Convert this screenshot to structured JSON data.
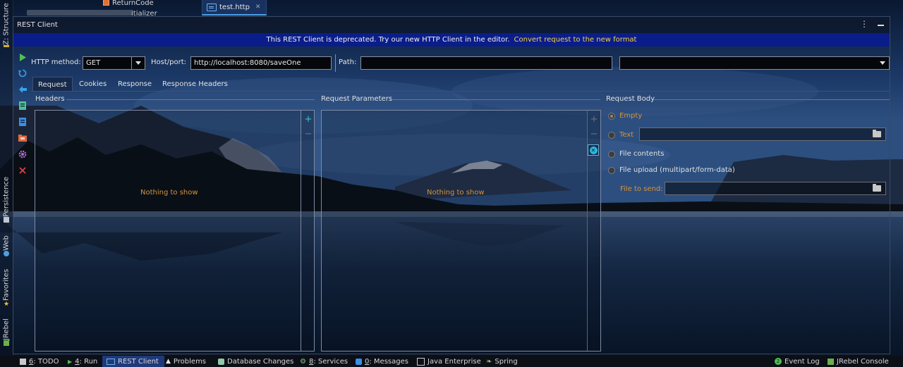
{
  "colors": {
    "banner_bg": "#0a1d8a",
    "banner_link": "#f3d24f",
    "empty_text": "#d7923a",
    "add_icon": "#3ac7c0",
    "status_active": "#1f3a7a"
  },
  "top": {
    "tree_item": "ReturnCode",
    "tree_item2": "itializer",
    "editor_tab": "test.http"
  },
  "left_tabs": [
    {
      "label": "Z: Structure",
      "icon": "structure-icon"
    },
    {
      "label": "Persistence",
      "icon": "persistence-icon"
    },
    {
      "label": "Web",
      "icon": "web-icon"
    },
    {
      "label": "Favorites",
      "icon": "star-icon"
    },
    {
      "label": "JRebel",
      "icon": "jrebel-icon"
    }
  ],
  "panel": {
    "title": "REST Client",
    "banner_text": "This REST Client is deprecated. Try our new HTTP Client in the editor.",
    "banner_link": "Convert request to the new format"
  },
  "toolbar": {
    "icons": [
      "run-icon",
      "refresh-icon",
      "back-icon",
      "export-icon",
      "import-icon",
      "open-folder-icon",
      "settings-icon",
      "close-icon"
    ]
  },
  "request": {
    "method_label": "HTTP method:",
    "method_value": "GET",
    "host_label": "Host/port:",
    "host_value": "http://localhost:8080/saveOne",
    "path_label": "Path:",
    "path_value": "",
    "extra_value": ""
  },
  "tabs": [
    "Request",
    "Cookies",
    "Response",
    "Response Headers"
  ],
  "sections": {
    "headers_title": "Headers",
    "params_title": "Request Parameters",
    "body_title": "Request Body",
    "empty_text": "Nothing to show"
  },
  "body": {
    "empty": "Empty",
    "text": "Text",
    "file_contents": "File contents",
    "file_upload": "File upload (multipart/form-data)",
    "file_to_send": "File to send:"
  },
  "status_bar": {
    "items": [
      {
        "key": "6",
        "label": ": TODO",
        "icon": "todo-icon"
      },
      {
        "key": "4",
        "label": ": Run",
        "icon": "run-icon"
      },
      {
        "key": "",
        "label": "REST Client",
        "icon": "rest-client-icon"
      },
      {
        "key": "",
        "label": "Problems",
        "icon": "warning-icon"
      },
      {
        "key": "",
        "label": "Database Changes",
        "icon": "database-icon"
      },
      {
        "key": "8",
        "label": ": Services",
        "icon": "services-icon"
      },
      {
        "key": "0",
        "label": ": Messages",
        "icon": "messages-icon"
      },
      {
        "key": "",
        "label": "Java Enterprise",
        "icon": "java-enterprise-icon"
      },
      {
        "key": "",
        "label": "Spring",
        "icon": "spring-icon"
      }
    ],
    "event_log_count": "2",
    "event_log": "Event Log",
    "jrebel_console": "JRebel Console"
  }
}
